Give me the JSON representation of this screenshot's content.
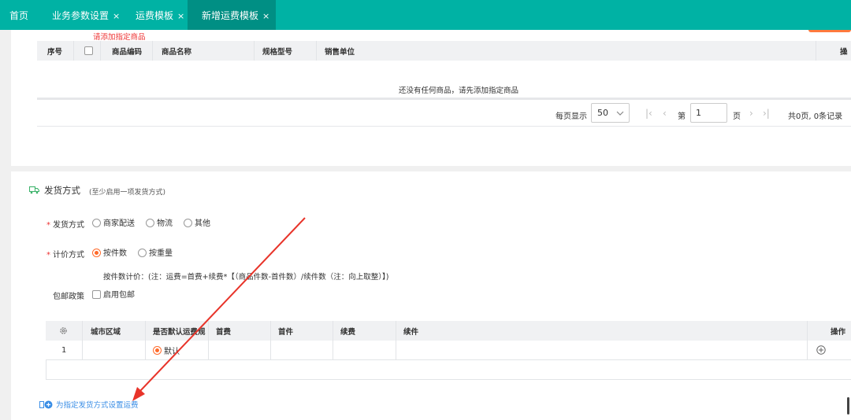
{
  "tabs": [
    {
      "label": "首页",
      "closable": false
    },
    {
      "label": "业务参数设置",
      "closable": true
    },
    {
      "label": "运费模板",
      "closable": true
    },
    {
      "label": "新增运费模板",
      "closable": true
    }
  ],
  "close_glyph": "×",
  "goods": {
    "warning": "请添加指定商品",
    "columns": [
      "序号",
      "",
      "商品编码",
      "商品名称",
      "规格型号",
      "销售单位",
      "操"
    ],
    "empty_text": "还没有任何商品，请先添加指定商品"
  },
  "pager": {
    "per_page_label": "每页显示",
    "per_page_value": "50",
    "page_prefix": "第",
    "page_value": "1",
    "page_suffix": "页",
    "summary": "共0页, 0条记录"
  },
  "shipping": {
    "title": "发货方式",
    "hint": "(至少启用一项发货方式)",
    "method_label": "发货方式",
    "methods": [
      "商家配送",
      "物流",
      "其他"
    ],
    "pricing_label": "计价方式",
    "pricing_options": [
      "按件数",
      "按重量"
    ],
    "pricing_selected": 0,
    "formula": "按件数计价：(注：运费=首费+续费*【（商品件数-首件数）/续件数（注：向上取整）】)",
    "free_label": "包邮政策",
    "free_checkbox": "启用包邮"
  },
  "rates": {
    "columns": [
      "",
      "城市区域",
      "是否默认运费规",
      "首费",
      "首件",
      "续费",
      "续件",
      "操作"
    ],
    "rows": [
      {
        "index": "1",
        "default_label": "默认"
      }
    ]
  },
  "add_link": "为指定发货方式设置运费",
  "colors": {
    "brand": "#00b2a4",
    "brand_dark": "#008f84",
    "accent": "#ff6a2a",
    "link": "#3a8ee6",
    "annotation": "#e8342a"
  },
  "icons": [
    "truck-icon",
    "gear-icon",
    "add-circle-icon",
    "chevron-down-icon",
    "first-page-icon",
    "prev-page-icon",
    "next-page-icon",
    "last-page-icon",
    "red-arrow-annotation"
  ]
}
